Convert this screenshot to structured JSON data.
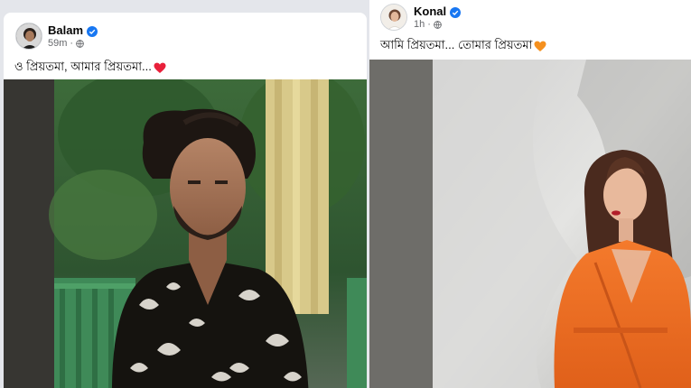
{
  "posts": [
    {
      "author": "Balam",
      "verified": true,
      "time": "59m",
      "audience_icon": "globe-icon",
      "caption": "ও প্রিয়তমা, আমার প্রিয়তমা...",
      "emoji": "red-heart-icon",
      "emoji_color": "#e8203a",
      "photo": "man-in-printed-shirt-photo"
    },
    {
      "author": "Konal",
      "verified": true,
      "time": "1h",
      "audience_icon": "globe-icon",
      "caption": "আমি প্রিয়তমা... তোমার প্রিয়তমা",
      "emoji": "orange-heart-icon",
      "emoji_color": "#f5901e",
      "photo": "woman-in-orange-coat-photo"
    }
  ],
  "colors": {
    "verified_badge": "#1877f2",
    "meta_text": "#65676b",
    "feed_background": "#e4e6eb"
  }
}
